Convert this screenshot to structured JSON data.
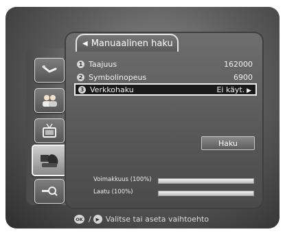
{
  "menu": {
    "title": "Manuaalinen haku",
    "rows": [
      {
        "num": "1",
        "label": "Taajuus",
        "value": "162000"
      },
      {
        "num": "2",
        "label": "Symbolinopeus",
        "value": "6900"
      },
      {
        "num": "3",
        "label": "Verkkohaku",
        "value": "Ei käyt."
      }
    ],
    "search_label": "Haku"
  },
  "meters": {
    "strength": {
      "label": "Voimakkuus (100%)",
      "percent": 100
    },
    "quality": {
      "label": "Laatu (100%)",
      "percent": 100
    }
  },
  "footer": {
    "ok_label": "OK",
    "separator": "/",
    "hint": "Valitse tai aseta vaihtoehto"
  },
  "sidebar": {
    "icons": [
      "installation-icon",
      "users-icon",
      "tv-antenna-icon",
      "satellite-search-icon",
      "key-lock-icon"
    ],
    "active_index": 3
  },
  "colors": {
    "panel": "#575757",
    "selected_row": "#1a1a1a",
    "meter_fill": "#f4f4f4"
  }
}
